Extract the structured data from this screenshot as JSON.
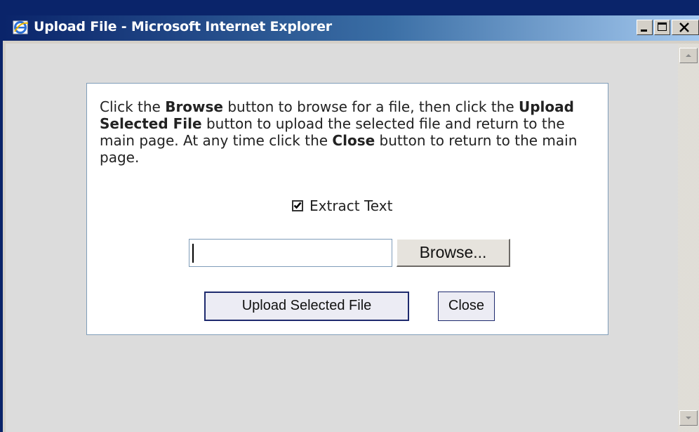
{
  "window": {
    "title": "Upload File - Microsoft Internet Explorer",
    "icon": "ie-icon",
    "controls": [
      "minimize-icon",
      "maximize-icon",
      "close-icon"
    ]
  },
  "dialog": {
    "instructions": {
      "part1": "Click the ",
      "browse_bold": "Browse",
      "part2": " button to browse for a file, then click the ",
      "upload_bold": "Upload Selected File",
      "part3": " button to upload the selected file and return to the main page. At any time click the ",
      "close_bold": "Close",
      "part4": " button to return to the main page."
    },
    "extract_text": {
      "label": "Extract Text",
      "checked": true
    },
    "file_input": {
      "value": ""
    },
    "browse_label": "Browse...",
    "upload_label": "Upload Selected File",
    "close_label": "Close"
  },
  "colors": {
    "titlebar_start": "#0a246a",
    "titlebar_end": "#a6caf0",
    "panel_border": "#7f9db9",
    "content_bg": "#dcdcdc"
  }
}
